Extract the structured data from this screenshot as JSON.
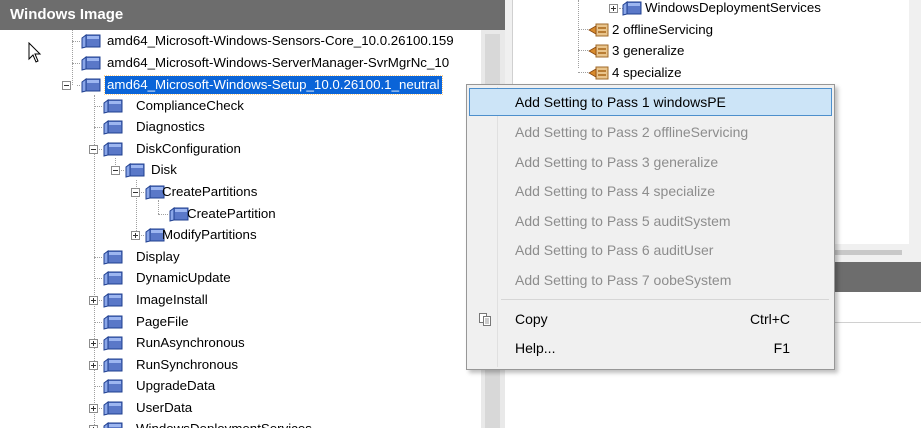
{
  "left_panel": {
    "title": "Windows Image",
    "tree": [
      {
        "label": "amd64_Microsoft-Windows-Sensors-Core_10.0.26100.159"
      },
      {
        "label": "amd64_Microsoft-Windows-ServerManager-SvrMgrNc_10"
      },
      {
        "label": "amd64_Microsoft-Windows-Setup_10.0.26100.1_neutral"
      },
      {
        "label": "ComplianceCheck"
      },
      {
        "label": "Diagnostics"
      },
      {
        "label": "DiskConfiguration"
      },
      {
        "label": "Disk"
      },
      {
        "label": "CreatePartitions"
      },
      {
        "label": "CreatePartition"
      },
      {
        "label": "ModifyPartitions"
      },
      {
        "label": "Display"
      },
      {
        "label": "DynamicUpdate"
      },
      {
        "label": "ImageInstall"
      },
      {
        "label": "PageFile"
      },
      {
        "label": "RunAsynchronous"
      },
      {
        "label": "RunSynchronous"
      },
      {
        "label": "UpgradeData"
      },
      {
        "label": "UserData"
      },
      {
        "label": "WindowsDeploymentServices"
      }
    ]
  },
  "answer_file": {
    "tree": [
      {
        "label": "WindowsDeploymentServices"
      },
      {
        "label": "2 offlineServicing"
      },
      {
        "label": "3 generalize"
      },
      {
        "label": "4 specialize"
      }
    ]
  },
  "context_menu": {
    "items": [
      {
        "label": "Add Setting to Pass 1 windowsPE",
        "state": "highlighted"
      },
      {
        "label": "Add Setting to Pass 2 offlineServicing",
        "state": "disabled"
      },
      {
        "label": "Add Setting to Pass 3 generalize",
        "state": "disabled"
      },
      {
        "label": "Add Setting to Pass 4 specialize",
        "state": "disabled"
      },
      {
        "label": "Add Setting to Pass 5 auditSystem",
        "state": "disabled"
      },
      {
        "label": "Add Setting to Pass 6 auditUser",
        "state": "disabled"
      },
      {
        "label": "Add Setting to Pass 7 oobeSystem",
        "state": "disabled"
      }
    ],
    "copy": {
      "label": "Copy",
      "shortcut": "Ctrl+C",
      "icon": "copy-icon"
    },
    "help": {
      "label": "Help...",
      "shortcut": "F1"
    }
  },
  "colors": {
    "header_bg": "#6d6d6d",
    "selection": "#0a64d8",
    "menu_highlight": "#cce4f7",
    "disabled_text": "#8d8d8d"
  }
}
